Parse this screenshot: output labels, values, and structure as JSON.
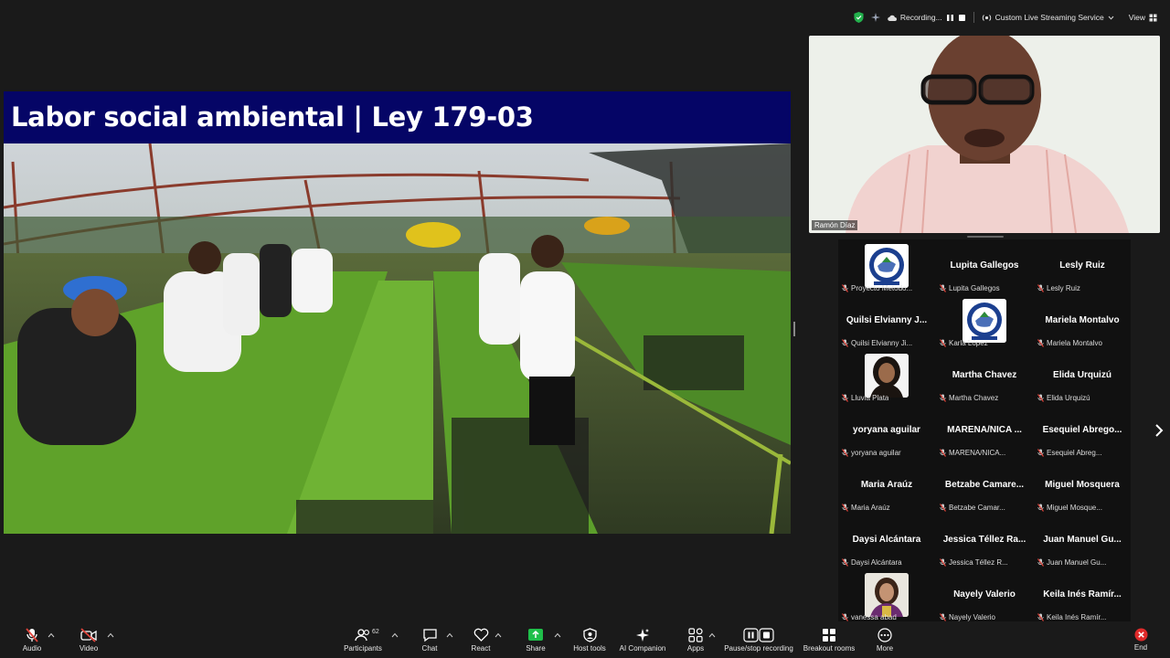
{
  "topbar": {
    "recording_text": "Recording...",
    "streaming_text": "Custom Live Streaming Service",
    "view_text": "View"
  },
  "slide": {
    "title": "Labor social ambiental | Ley 179-03"
  },
  "speaker": {
    "name": "Ramón Díaz"
  },
  "gallery": {
    "tiles": [
      {
        "name": "",
        "label": "Proyecto Metodo...",
        "avatar": "logo"
      },
      {
        "name": "Lupita Gallegos",
        "label": "Lupita Gallegos"
      },
      {
        "name": "Lesly Ruiz",
        "label": "Lesly Ruiz"
      },
      {
        "name": "Quilsi  Elvianny  J...",
        "label": "Quilsi Elvianny Ji..."
      },
      {
        "name": "",
        "label": "Karla López",
        "avatar": "logo"
      },
      {
        "name": "Mariela Montalvo",
        "label": "Mariela Montalvo"
      },
      {
        "name": "",
        "label": "Lluvia Plata",
        "avatar": "woman"
      },
      {
        "name": "Martha Chavez",
        "label": "Martha Chavez"
      },
      {
        "name": "Elida Urquizú",
        "label": "Elida Urquizú"
      },
      {
        "name": "yoryana aguilar",
        "label": "yoryana aguilar"
      },
      {
        "name": "MARENA/NICA ...",
        "label": "MARENA/NICA..."
      },
      {
        "name": "Esequiel  Abrego...",
        "label": "Esequiel Abreg..."
      },
      {
        "name": "Maria Araúz",
        "label": "Maria Araúz"
      },
      {
        "name": "Betzabe  Camare...",
        "label": "Betzabe Camar..."
      },
      {
        "name": "Miguel Mosquera",
        "label": "Miguel Mosque..."
      },
      {
        "name": "Daysi Alcántara",
        "label": "Daysi Alcántara"
      },
      {
        "name": "Jessica  Téllez  Ra...",
        "label": "Jessica Téllez R..."
      },
      {
        "name": "Juan Manuel  Gu...",
        "label": "Juan Manuel Gu..."
      },
      {
        "name": "",
        "label": "vanessa abad",
        "avatar": "woman2"
      },
      {
        "name": "Nayely Valerio",
        "label": "Nayely Valerio"
      },
      {
        "name": "Keila Inés  Ramír...",
        "label": "Keila Inés Ramír..."
      }
    ]
  },
  "toolbar": {
    "audio": "Audio",
    "video": "Video",
    "participants": "Participants",
    "participants_count": "62",
    "chat": "Chat",
    "react": "React",
    "share": "Share",
    "host_tools": "Host tools",
    "ai_companion": "AI Companion",
    "apps": "Apps",
    "record": "Pause/stop recording",
    "breakout": "Breakout rooms",
    "more": "More",
    "end": "End"
  },
  "colors": {
    "slide_title_bg": "#050566",
    "share_green": "#1fbf4a",
    "end_red": "#e02a2a",
    "mic_muted_red": "#e0443b"
  }
}
